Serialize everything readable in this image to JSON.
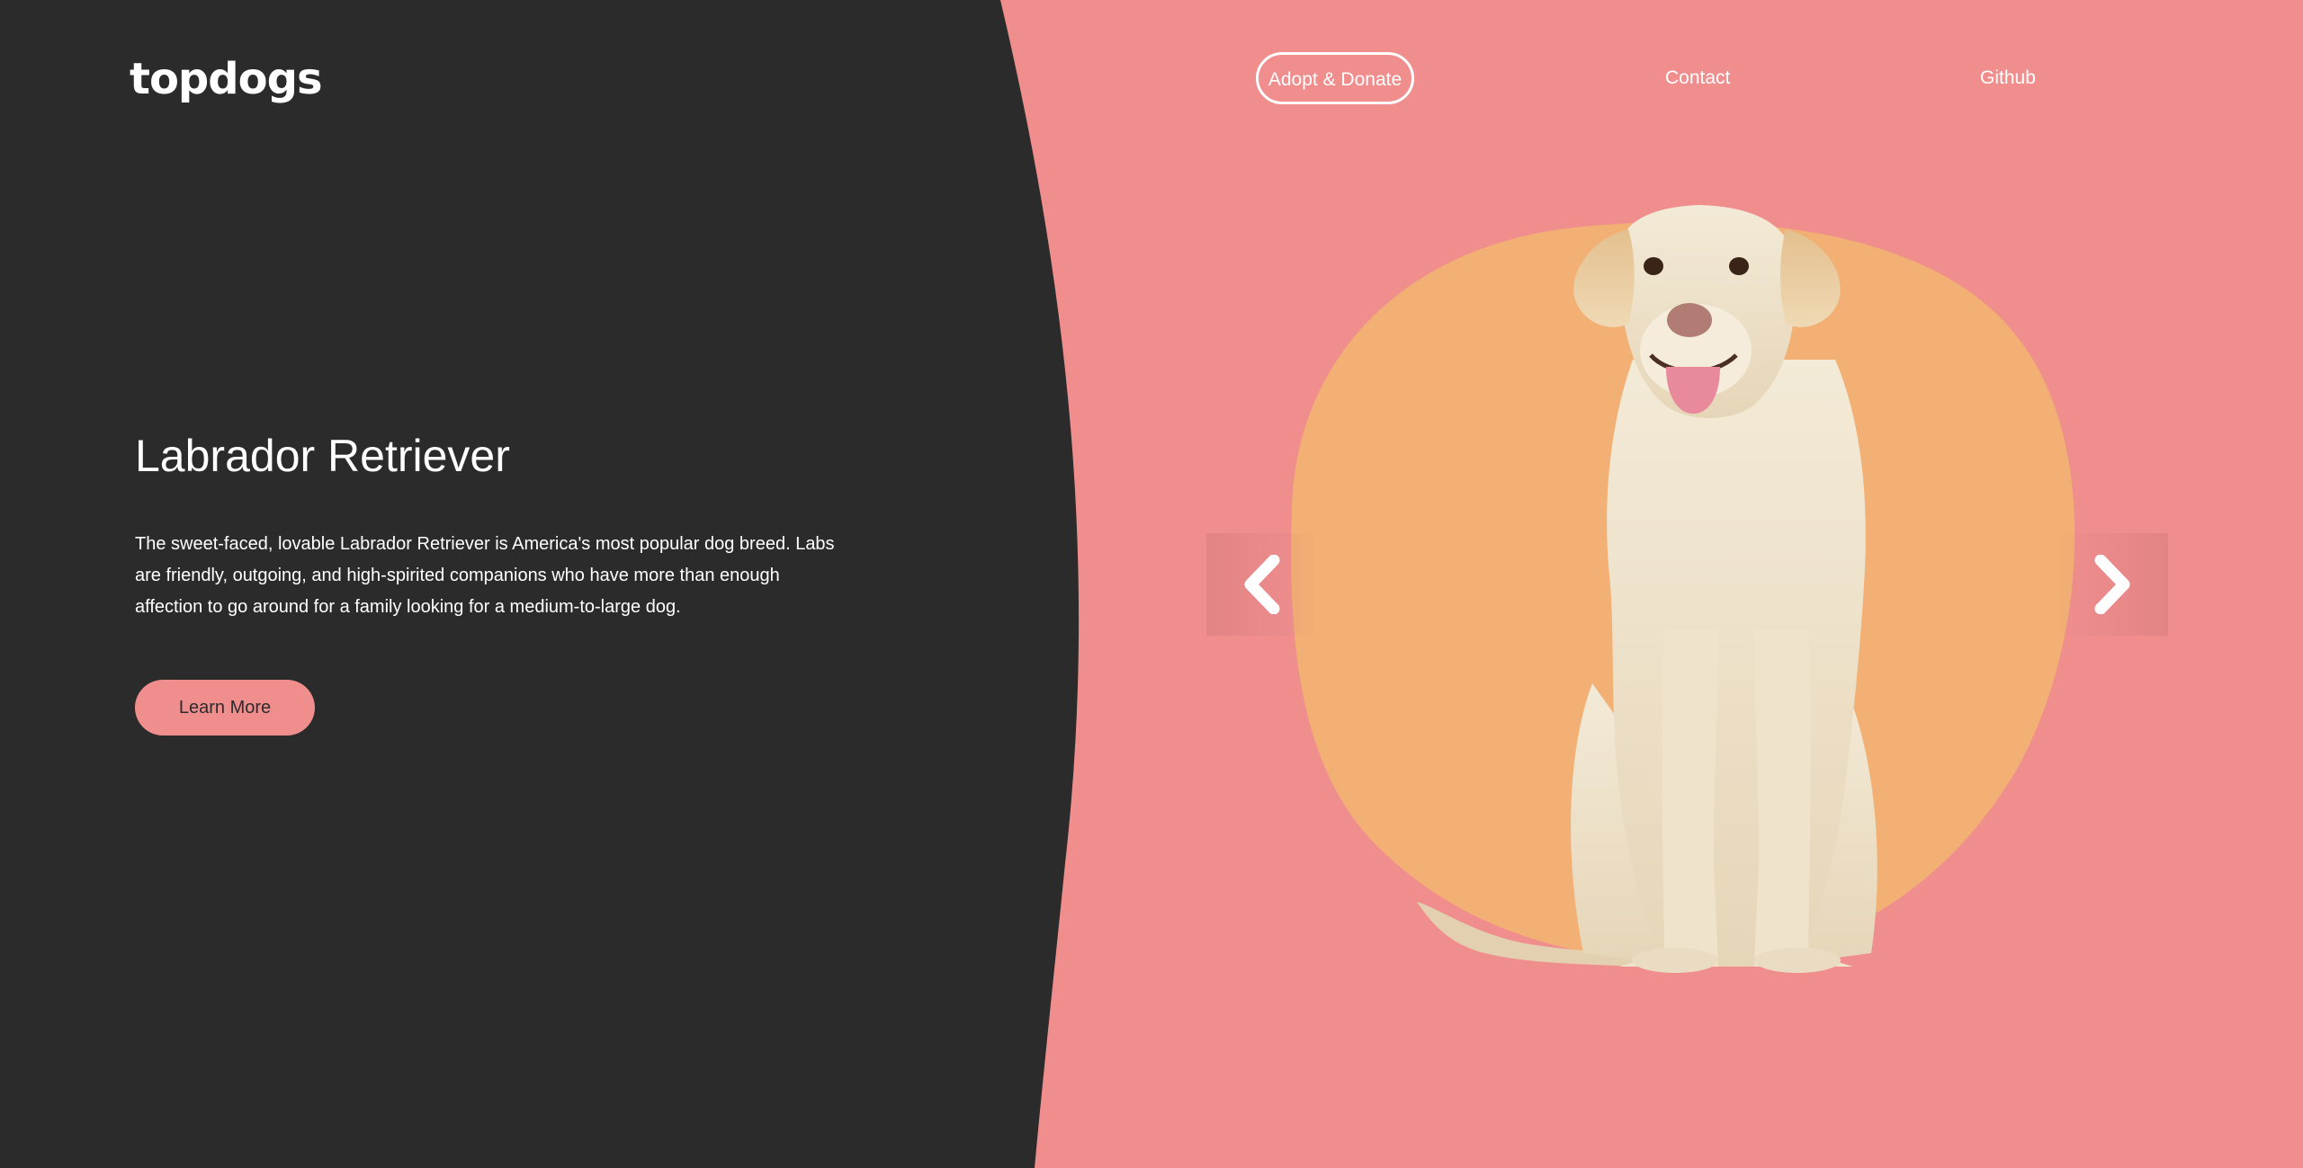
{
  "brand": {
    "logo_text": "topdogs",
    "dark_color": "#2b2b2b",
    "pink_color": "#f08e8e",
    "orange_color": "#f2b074"
  },
  "nav": {
    "items": [
      {
        "label": "Adopt & Donate"
      },
      {
        "label": "Contact"
      },
      {
        "label": "Github"
      }
    ]
  },
  "hero": {
    "title": "Labrador Retriever",
    "description": "The sweet-faced, lovable Labrador Retriever is America's most popular dog breed. Labs are friendly, outgoing, and high-spirited companions who have more than enough affection to go around for a family looking for a medium-to-large dog.",
    "cta_label": "Learn More"
  },
  "carousel": {
    "image": "labrador-retriever",
    "prev_icon": "chevron-left-icon",
    "next_icon": "chevron-right-icon"
  }
}
